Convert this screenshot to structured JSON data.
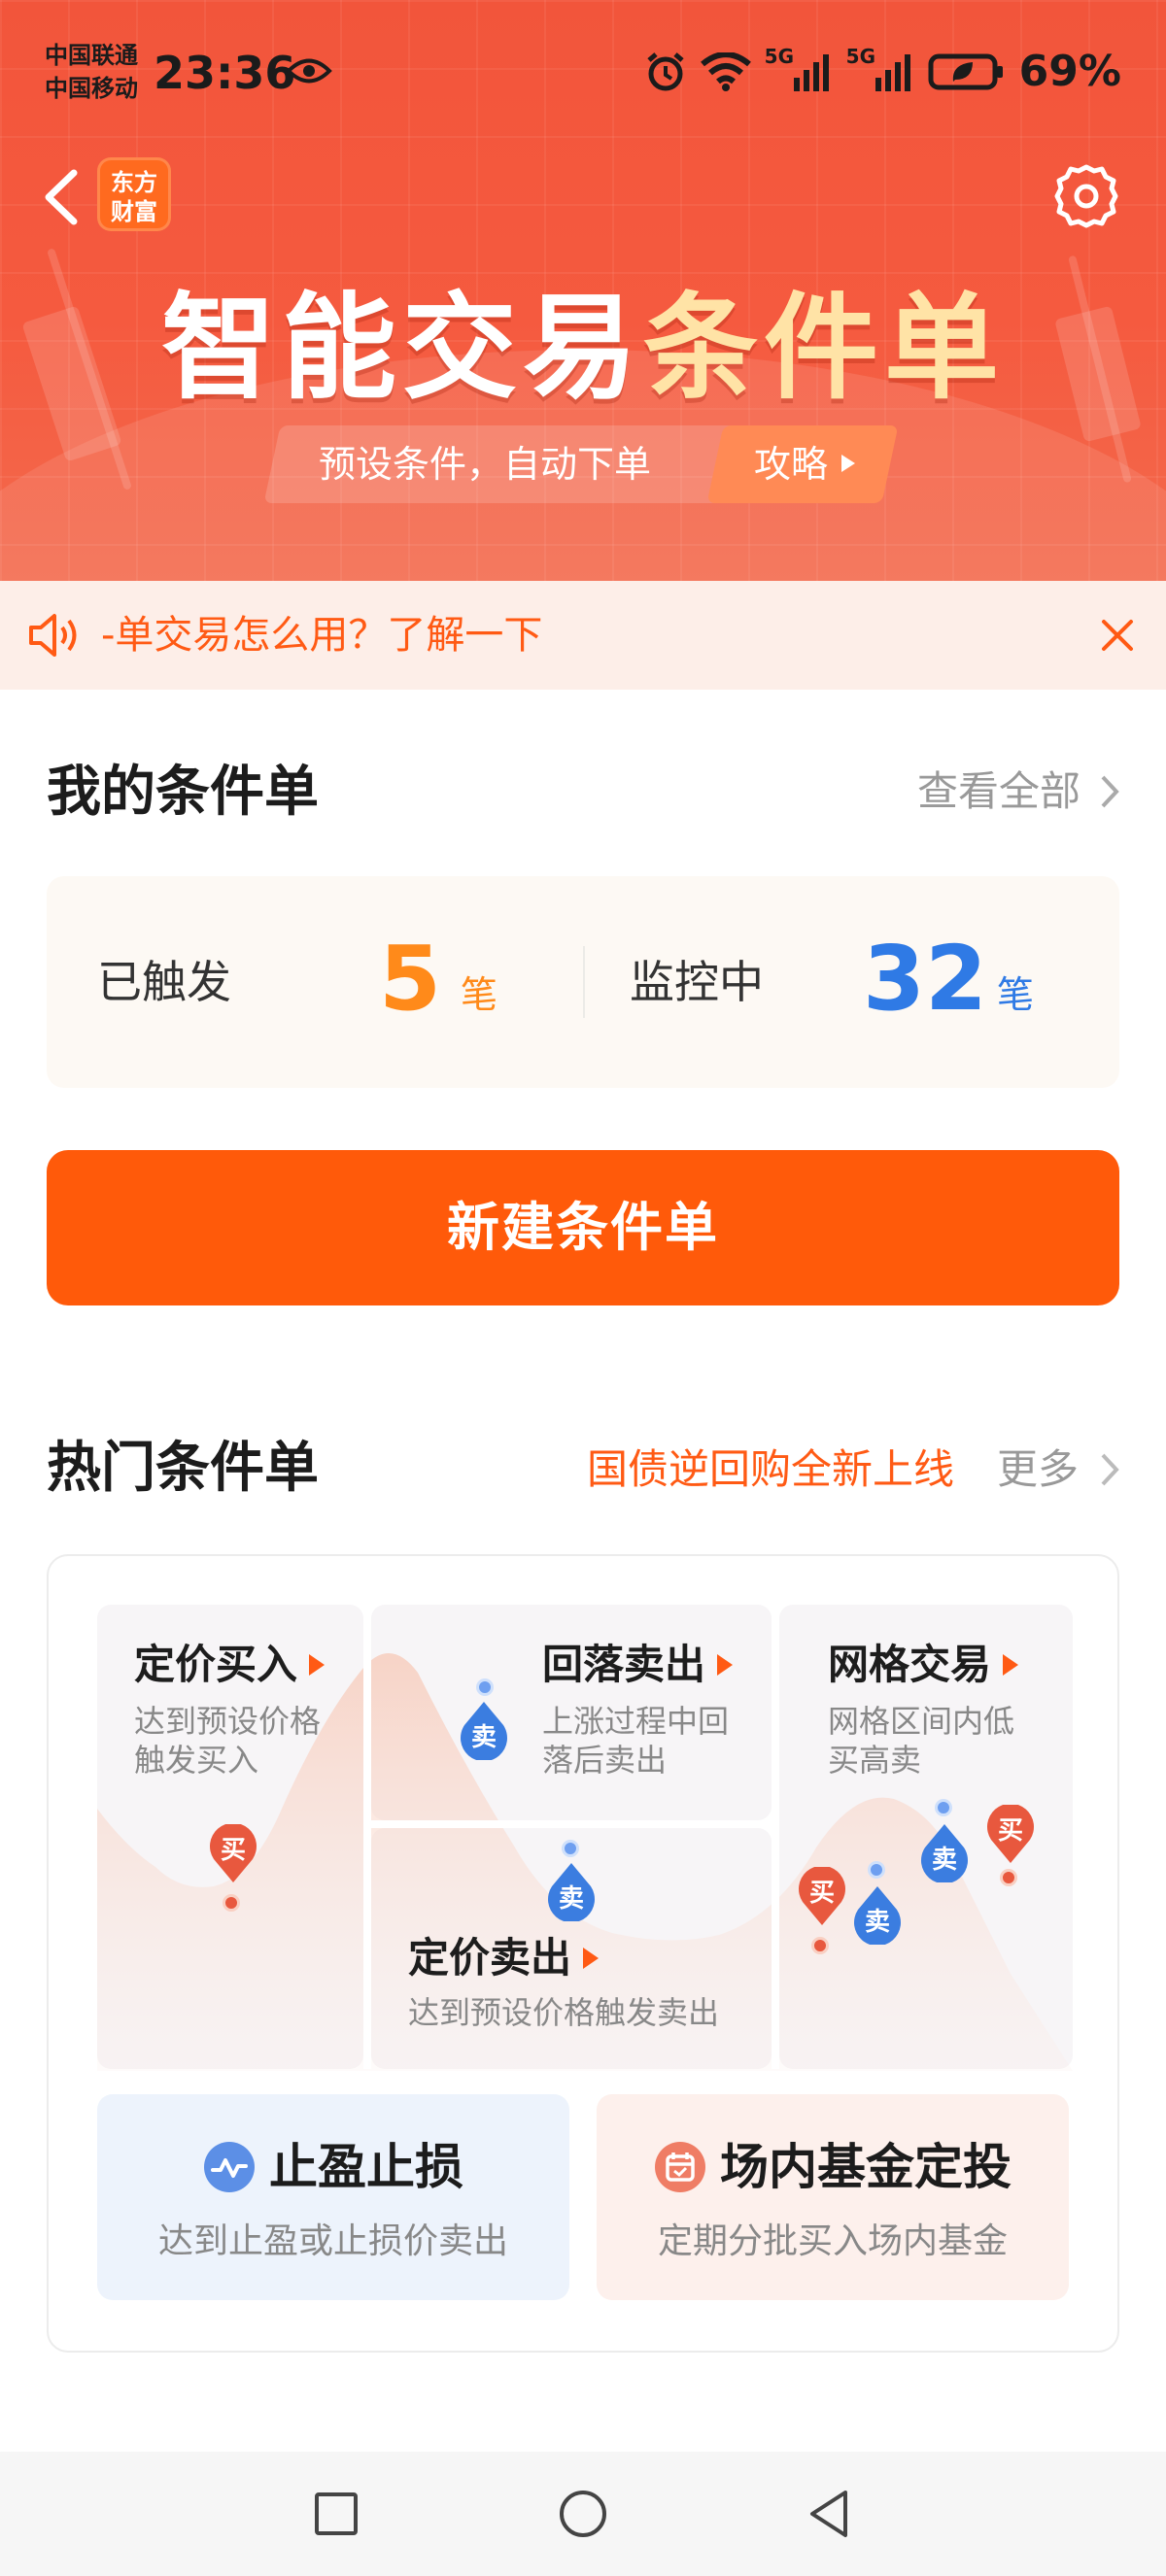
{
  "status_bar": {
    "carrier_1": "中国联通",
    "carrier_2": "中国移动",
    "time": "23:36",
    "battery": "69%",
    "network_1": "5G",
    "network_2": "5G",
    "icons": [
      "eye-icon",
      "alarm-icon",
      "wifi-icon",
      "signal-icon",
      "battery-icon"
    ]
  },
  "header": {
    "logo_line1": "东方",
    "logo_line2": "财富",
    "title_main": "智能交易",
    "title_accent": "条件单",
    "subtitle": "预设条件，自动下单",
    "guide_label": "攻略"
  },
  "notice": {
    "text": "-单交易怎么用？了解一下"
  },
  "my_orders": {
    "title": "我的条件单",
    "view_all": "查看全部",
    "triggered_label": "已触发",
    "triggered_count": "5",
    "triggered_unit": "笔",
    "monitoring_label": "监控中",
    "monitoring_count": "32",
    "monitoring_unit": "笔"
  },
  "new_order_button": "新建条件单",
  "hot_orders": {
    "title": "热门条件单",
    "promo_link": "国债逆回购全新上线",
    "more": "更多",
    "tiles": {
      "fixed_buy": {
        "title": "定价买入",
        "desc_1": "达到预设价格",
        "desc_2": "触发买入"
      },
      "pullback_sell": {
        "title": "回落卖出",
        "desc_1": "上涨过程中回",
        "desc_2": "落后卖出"
      },
      "grid_trade": {
        "title": "网格交易",
        "desc_1": "网格区间内低",
        "desc_2": "买高卖"
      },
      "fixed_sell": {
        "title": "定价卖出",
        "desc": "达到预设价格触发卖出"
      }
    },
    "markers": {
      "buy": "买",
      "sell": "卖"
    },
    "features": {
      "stop": {
        "title": "止盈止损",
        "desc": "达到止盈或止损价卖出"
      },
      "fund": {
        "title": "场内基金定投",
        "desc": "定期分批买入场内基金"
      }
    }
  },
  "colors": {
    "brand_red": "#f2553b",
    "accent_orange": "#ff5a0a",
    "triggered": "#ff8a1a",
    "monitoring": "#2f7ae5"
  }
}
